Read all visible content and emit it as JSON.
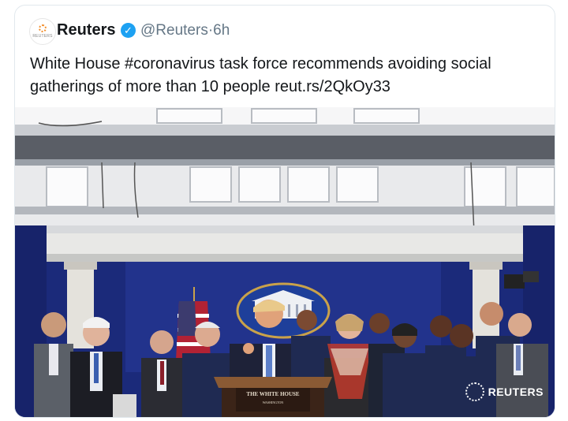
{
  "tweet": {
    "author_name": "Reuters",
    "handle": "@Reuters",
    "separator": "·",
    "time": "6h",
    "text": "White House #coronavirus task force recommends avoiding social gatherings of more than 10 people reut.rs/2QkOy33",
    "avatar_label": "REUTERS"
  },
  "photo": {
    "podium_text_line1": "THE WHITE HOUSE",
    "podium_text_line2": "WASHINGTON",
    "watermark": "REUTERS"
  },
  "colors": {
    "verified": "#1da1f2",
    "handle": "#657786",
    "backdrop": "#1b2a7a"
  }
}
